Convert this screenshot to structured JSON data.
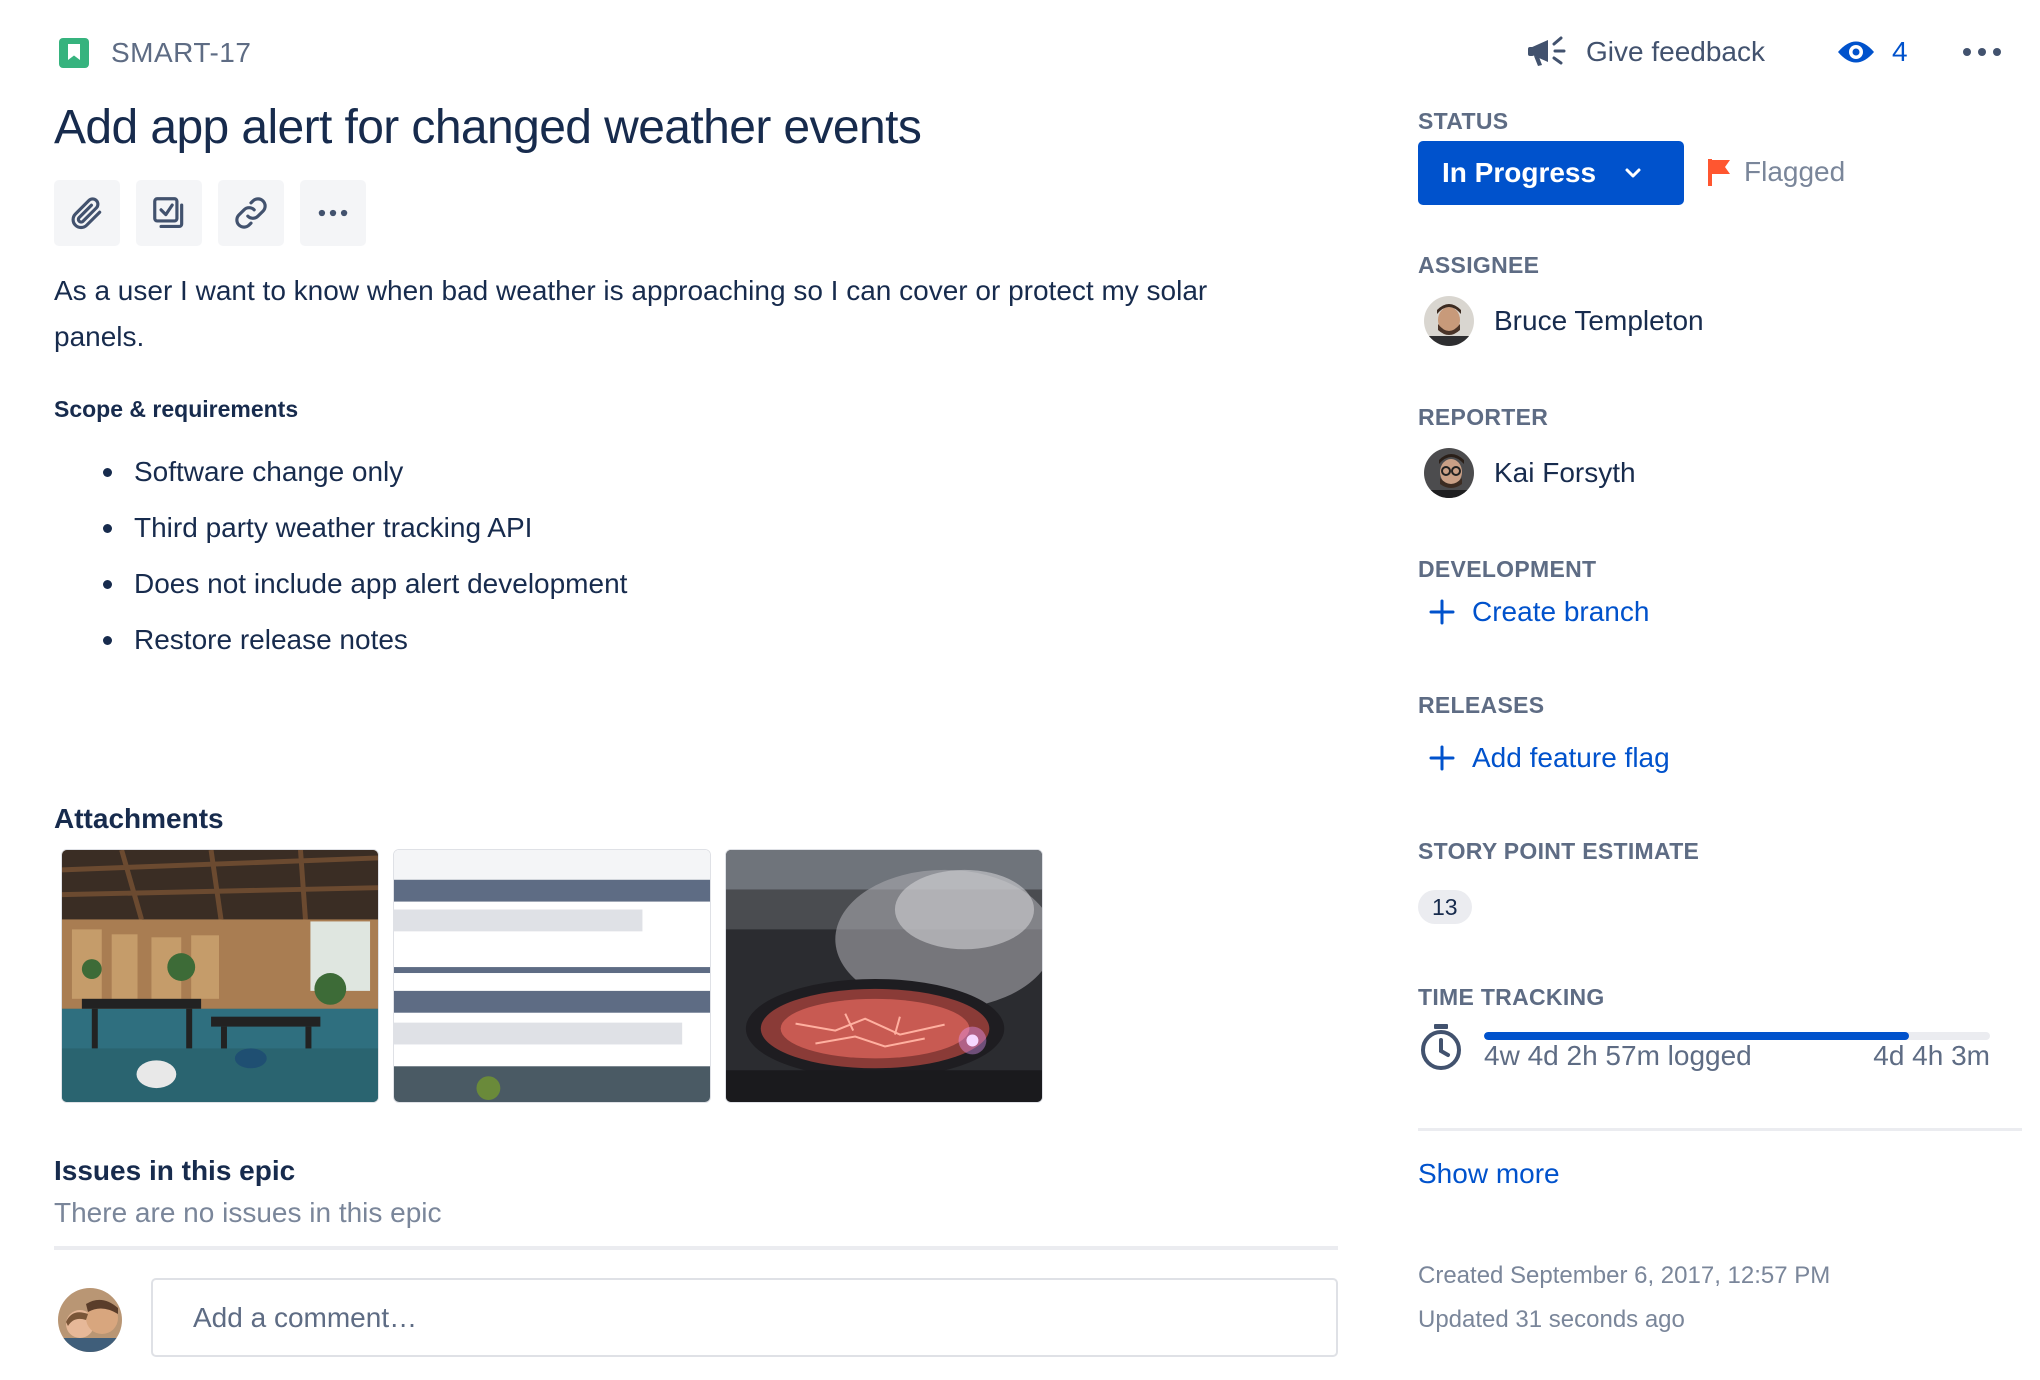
{
  "header": {
    "issue_key": "SMART-17",
    "feedback_label": "Give feedback",
    "watchers_count": "4",
    "icons": {
      "feedback": "megaphone-icon",
      "watch": "eye-icon",
      "more": "more-icon"
    }
  },
  "issue": {
    "summary": "Add app alert for changed weather events",
    "toolbar": [
      "attach-icon",
      "subtask-icon",
      "link-icon",
      "more-icon"
    ],
    "description": "As a user I want to know when bad weather is approaching so I can cover or protect my solar panels.",
    "scope_title": "Scope & requirements",
    "scope_items": [
      "Software change only",
      "Third party weather tracking API",
      "Does not include app alert development",
      "Restore release notes"
    ]
  },
  "attachments": {
    "title": "Attachments",
    "items": [
      "office-interior-thumbnail",
      "app-screenshot-thumbnail",
      "volcano-crater-thumbnail"
    ]
  },
  "epic": {
    "title": "Issues in this epic",
    "empty_text": "There are no issues in this epic"
  },
  "comment": {
    "placeholder": "Add a comment…"
  },
  "sidebar": {
    "status": {
      "label": "STATUS",
      "value": "In Progress",
      "flag": "Flagged",
      "flag_color": "#ff5630"
    },
    "assignee": {
      "label": "ASSIGNEE",
      "name": "Bruce Templeton"
    },
    "reporter": {
      "label": "REPORTER",
      "name": "Kai Forsyth"
    },
    "development": {
      "label": "DEVELOPMENT",
      "action": "Create branch"
    },
    "releases": {
      "label": "RELEASES",
      "action": "Add feature flag"
    },
    "story_points": {
      "label": "STORY POINT ESTIMATE",
      "value": "13"
    },
    "time_tracking": {
      "label": "TIME TRACKING",
      "logged": "4w 4d 2h 57m logged",
      "remaining": "4d 4h 3m",
      "progress": 0.84
    },
    "show_more": "Show more",
    "created": "Created September 6, 2017, 12:57 PM",
    "updated": "Updated 31 seconds ago"
  },
  "colors": {
    "primary": "#0052cc",
    "story": "#36b37e",
    "flag": "#ff5630",
    "text": "#172b4d",
    "subtle": "#5e6c84"
  }
}
